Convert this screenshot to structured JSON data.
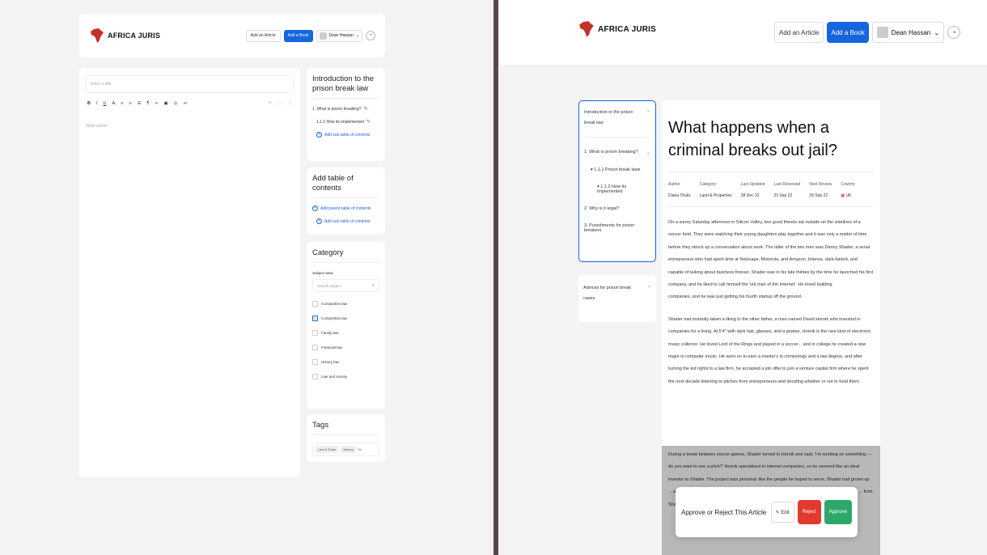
{
  "left": {
    "brand": "AFRICA JURIS",
    "header": {
      "add_article": "Add an Article",
      "add_book": "Add a Book",
      "user_name": "Dean Hassan"
    },
    "editor": {
      "title_placeholder": "Enter a title",
      "body_placeholder": "Write article...",
      "toolbar": [
        "B",
        "I",
        "U",
        "A̶",
        "≡",
        "≡",
        "☰",
        "¶",
        "∞",
        "▣",
        "◎",
        "+ı"
      ],
      "undo": "↶",
      "redo": "→",
      "more": "⋮"
    },
    "toc_panel": {
      "title": "Introduction to the prison break law",
      "items": [
        "1. What is prison breaking?",
        "1.1.1 How its implemented"
      ],
      "add_sub": "Add sub table of contents"
    },
    "add_panel": {
      "title": "Add table of contents",
      "add_parent": "Add parent table of contents",
      "add_sub": "Add sub table of contents"
    },
    "category_panel": {
      "title": "Category",
      "subject_label": "Subject area",
      "search_placeholder": "Search subject",
      "options": [
        {
          "label": "Comparitive law",
          "checked": false
        },
        {
          "label": "Competition law",
          "checked": true
        },
        {
          "label": "Family law",
          "checked": false
        },
        {
          "label": "Financial law",
          "checked": false
        },
        {
          "label": "History law",
          "checked": false
        },
        {
          "label": "Law and society",
          "checked": false
        }
      ]
    },
    "tags_panel": {
      "title": "Tags",
      "tags": [
        "Law & Order",
        "History"
      ],
      "input_value": "Di"
    }
  },
  "right": {
    "brand": "AFRICA JURIS",
    "header": {
      "add_article": "Add an Article",
      "add_book": "Add a Book",
      "user_name": "Dean Hassan"
    },
    "toc": {
      "title": "Introduction to the prison break law",
      "items": [
        {
          "label": "1. What is prison breaking?",
          "level": 0
        },
        {
          "label": "▾ 1.1.1 Prison break laws",
          "level": 1
        },
        {
          "label": "▾ 1.1.2 How its implemented",
          "level": 2
        },
        {
          "label": "2. Why is it legal?",
          "level": 0
        },
        {
          "label": "3. Punishments for prison breakers",
          "level": 0
        }
      ]
    },
    "toc2": {
      "title": "Advices for prison break cases"
    },
    "article": {
      "title": "What happens when a criminal breaks out jail?",
      "meta": [
        {
          "key": "Author",
          "value": "Diana Thulis"
        },
        {
          "key": "Category",
          "value": "Land & Properties"
        },
        {
          "key": "Last Updated",
          "value": "28 Dec 22"
        },
        {
          "key": "Last Reviewed",
          "value": "23 Sep 22"
        },
        {
          "key": "Next Review",
          "value": "29 Sep 22"
        },
        {
          "key": "Country",
          "value": "UK"
        }
      ],
      "para1": "On a sunny Saturday afternoon in Silicon Valley, two good friends sat outside on the sidelines of a soccer field. They were watching their young daughters play together and it was only a matter of time before they struck up a conversation about work. The taller of the two men was Danny Shader, a serial entrepreneur who had spent time at Netscape, Motorola, and Amazon. Intense, dark-haired, and capable of talking about business forever, Shader was in his late thirties by the time he launched his first company, and he liked to call himself the 'old man of the Internet'. He loved building",
      "para1b": "companies, and he was just getting his fourth startup off the ground.",
      "para2": "Shader had instantly taken a liking to the other father, a man named David Hornik who invested in companies for a living. At 5'4\" with dark hair, glasses, and a goatee, Hornik is the rare kind of electronic music collector. He loved Lord of the Rings and played in a soccer... and in college he created a new major in computer music. He went on to earn a master's in criminology and a law degree, and after turning the kid rights to a law firm, he accepted a job offer to join a venture capital firm where he spent the next decade listening to pitches from entrepreneurs and deciding whether or not to fund them.",
      "highlight": "During a break between soccer games, Shader turned to Hornik and said, 'I'm working on something — do you want to see a pitch?' Hornik specialized in internet companies, so he seemed like an ideal investor to Shader. The project was personal: like the people he hoped to serve, Shader had grown up ... and his ... was in ... Hornik wasn't sure yet, but ... to Hornik's ... Shader's ... that had ... $5,000 ... from Shader's ... Hornik was eager to hear what he was about to see."
    },
    "approve_bar": {
      "label": "Approve or Reject This Article",
      "edit": "Edit",
      "reject": "Reject",
      "approve": "Approve"
    }
  }
}
